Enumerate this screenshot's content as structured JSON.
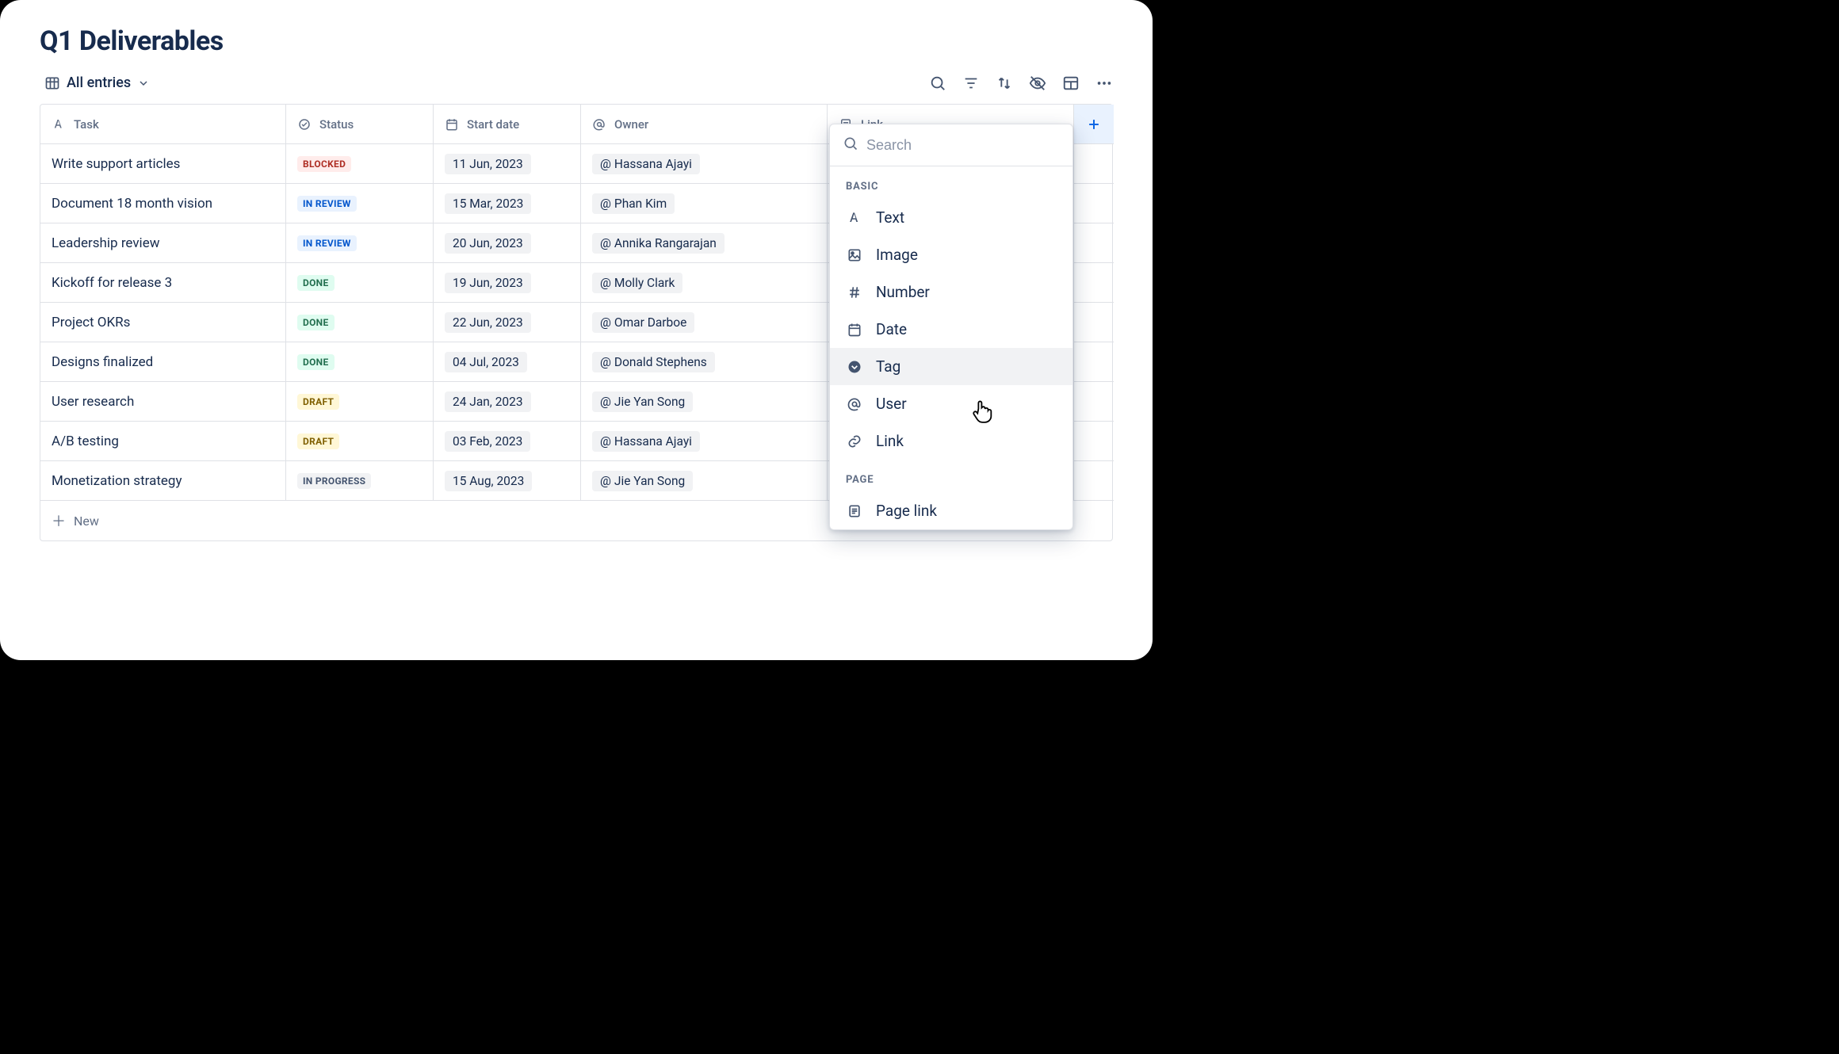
{
  "title": "Q1 Deliverables",
  "view": {
    "label": "All entries"
  },
  "columns": {
    "task": "Task",
    "status": "Status",
    "start": "Start date",
    "owner": "Owner",
    "link": "Link"
  },
  "rows": [
    {
      "task": "Write support articles",
      "status": "BLOCKED",
      "status_class": "blocked",
      "date": "11 Jun, 2023",
      "owner": "Hassana Ajayi"
    },
    {
      "task": "Document 18 month vision",
      "status": "IN REVIEW",
      "status_class": "in-review",
      "date": "15 Mar, 2023",
      "owner": "Phan Kim"
    },
    {
      "task": "Leadership review",
      "status": "IN REVIEW",
      "status_class": "in-review",
      "date": "20 Jun, 2023",
      "owner": "Annika Rangarajan"
    },
    {
      "task": "Kickoff for release 3",
      "status": "DONE",
      "status_class": "done",
      "date": "19 Jun, 2023",
      "owner": "Molly Clark"
    },
    {
      "task": "Project OKRs",
      "status": "DONE",
      "status_class": "done",
      "date": "22 Jun, 2023",
      "owner": "Omar Darboe"
    },
    {
      "task": "Designs finalized",
      "status": "DONE",
      "status_class": "done",
      "date": "04 Jul, 2023",
      "owner": "Donald Stephens"
    },
    {
      "task": "User research",
      "status": "DRAFT",
      "status_class": "draft",
      "date": "24 Jan, 2023",
      "owner": "Jie Yan Song"
    },
    {
      "task": "A/B testing",
      "status": "DRAFT",
      "status_class": "draft",
      "date": "03 Feb, 2023",
      "owner": "Hassana Ajayi"
    },
    {
      "task": "Monetization strategy",
      "status": "IN PROGRESS",
      "status_class": "in-progress",
      "date": "15 Aug, 2023",
      "owner": "Jie Yan Song"
    }
  ],
  "new_row_label": "New",
  "popover": {
    "search_placeholder": "Search",
    "section_basic": "BASIC",
    "section_page": "PAGE",
    "options": {
      "text": "Text",
      "image": "Image",
      "number": "Number",
      "date": "Date",
      "tag": "Tag",
      "user": "User",
      "link": "Link",
      "pagelink": "Page link"
    }
  }
}
